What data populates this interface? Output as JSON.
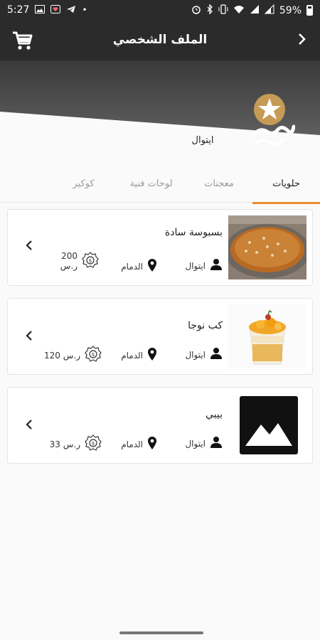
{
  "status_bar": {
    "time": "5:27",
    "battery": "59%"
  },
  "app_bar": {
    "title": "الملف الشخصي"
  },
  "store": {
    "name": "ايتوال"
  },
  "tabs": [
    {
      "label": "حلويات",
      "active": true
    },
    {
      "label": "معجنات",
      "active": false
    },
    {
      "label": "لوحات فنية",
      "active": false
    },
    {
      "label": "كوكير",
      "active": false
    }
  ],
  "products": [
    {
      "name": "بسبوسة سادة",
      "seller": "ايتوال",
      "city": "الدمام",
      "price_amount": "200",
      "price_unit": "ر.س"
    },
    {
      "name": "كب نوجا",
      "seller": "ايتوال",
      "city": "الدمام",
      "price": "120 ر.س"
    },
    {
      "name": "بيبي",
      "seller": "ايتوال",
      "city": "الدمام",
      "price": "33 ر.س"
    }
  ],
  "colors": {
    "bar": "#2b2b2b",
    "accent": "#ee8a2e",
    "logo_gold": "#c59b55"
  }
}
